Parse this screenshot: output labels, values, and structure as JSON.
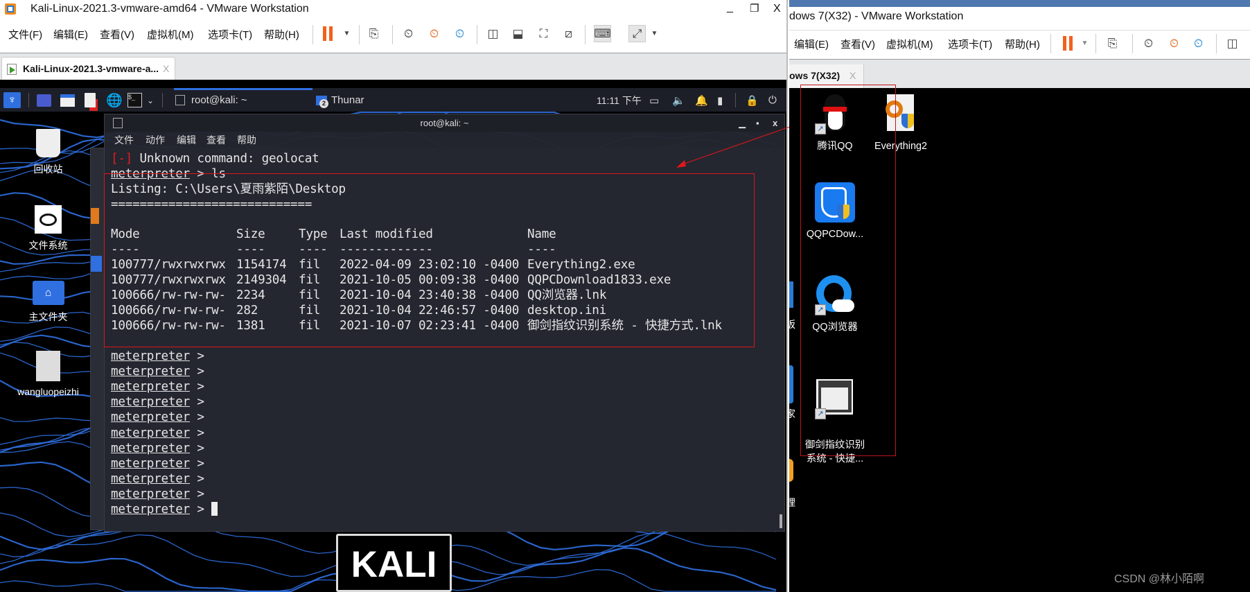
{
  "left_window": {
    "title": "Kali-Linux-2021.3-vmware-amd64 - VMware Workstation",
    "controls": {
      "minimize": "_",
      "restore": "❐",
      "close": "X"
    },
    "menu": [
      "文件(F)",
      "编辑(E)",
      "查看(V)",
      "虚拟机(M)",
      "选项卡(T)",
      "帮助(H)"
    ],
    "tab_label": "Kali-Linux-2021.3-vmware-a...",
    "tab_close": "X"
  },
  "kali": {
    "panel": {
      "task_terminal": "root@kali: ~",
      "task_thunar": "Thunar",
      "thunar_count": "2",
      "clock": "11:11 下午"
    },
    "desktop_icons": [
      "回收站",
      "文件系统",
      "主文件夹",
      "wangluopeizhi"
    ],
    "logo": "KALI"
  },
  "terminal": {
    "title": "root@kali: ~",
    "menu": [
      "文件",
      "动作",
      "编辑",
      "查看",
      "帮助"
    ],
    "error_tag": "[-]",
    "error_text": " Unknown command: geolocat",
    "prompt": "meterpreter",
    "prompt_sep": " > ",
    "command": "ls",
    "listing": "Listing: C:\\Users\\夏雨紫陌\\Desktop",
    "listing_rule": "============================",
    "headers": [
      "Mode",
      "Size",
      "Type",
      "Last modified",
      "Name"
    ],
    "header_rules": [
      "----",
      "----",
      "----",
      "-------------",
      "----"
    ],
    "files": [
      {
        "mode": "100777/rwxrwxrwx",
        "size": "1154174",
        "type": "fil",
        "modified": "2022-04-09 23:02:10 -0400",
        "name": "Everything2.exe"
      },
      {
        "mode": "100777/rwxrwxrwx",
        "size": "2149304",
        "type": "fil",
        "modified": "2021-10-05 00:09:38 -0400",
        "name": "QQPCDownload1833.exe"
      },
      {
        "mode": "100666/rw-rw-rw-",
        "size": "2234",
        "type": "fil",
        "modified": "2021-10-04 23:40:38 -0400",
        "name": "QQ浏览器.lnk"
      },
      {
        "mode": "100666/rw-rw-rw-",
        "size": "282",
        "type": "fil",
        "modified": "2021-10-04 22:46:57 -0400",
        "name": "desktop.ini"
      },
      {
        "mode": "100666/rw-rw-rw-",
        "size": "1381",
        "type": "fil",
        "modified": "2021-10-07 02:23:41 -0400",
        "name": "御剑指纹识别系统 - 快捷方式.lnk"
      }
    ],
    "empty_prompt_count": 11
  },
  "right_window": {
    "title": "dows 7(X32) - VMware Workstation",
    "menu": [
      "编辑(E)",
      "查看(V)",
      "虚拟机(M)",
      "选项卡(T)",
      "帮助(H)"
    ],
    "tab_label": "ows 7(X32)",
    "tab_close": "X",
    "desktop_icons": [
      {
        "label": "腾讯QQ"
      },
      {
        "label": "Everything2"
      },
      {
        "label": "QQPCDow..."
      },
      {
        "label": "QQ浏览器"
      },
      {
        "label": "御剑指纹识别\n系统 - 快捷..."
      }
    ],
    "edge_chars": [
      "板",
      "家",
      "理"
    ]
  },
  "watermark": "CSDN @林小陌啊",
  "colors": {
    "annotation_red": "#e0161c",
    "kali_blue": "#2f6fe0",
    "pause_orange": "#f0611f"
  }
}
